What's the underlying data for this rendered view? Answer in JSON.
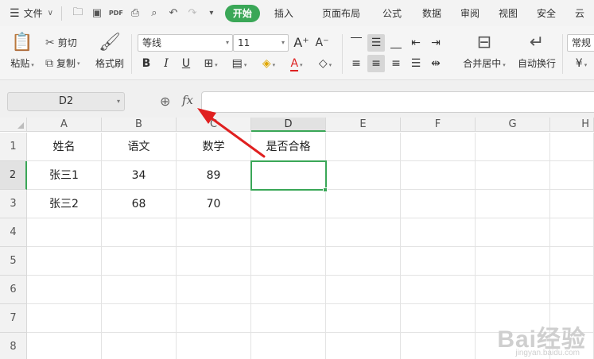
{
  "menubar": {
    "file_label": "文件",
    "tabs": [
      {
        "label": "开始",
        "active": true
      },
      {
        "label": "插入"
      },
      {
        "label": "页面布局"
      },
      {
        "label": "公式"
      },
      {
        "label": "数据"
      },
      {
        "label": "审阅"
      },
      {
        "label": "视图"
      },
      {
        "label": "安全"
      },
      {
        "label": "云"
      }
    ]
  },
  "ribbon": {
    "paste_label": "粘贴",
    "cut_label": "剪切",
    "copy_label": "复制",
    "format_painter_label": "格式刷",
    "font_name": "等线",
    "font_size": "11",
    "merge_center_label": "合并居中",
    "wrap_text_label": "自动换行",
    "number_format": "常规"
  },
  "formula_bar": {
    "name_box": "D2",
    "fx_label": "fx",
    "formula": ""
  },
  "sheet": {
    "columns": [
      "A",
      "B",
      "C",
      "D",
      "E",
      "F",
      "G",
      "H"
    ],
    "rows": [
      "1",
      "2",
      "3",
      "4",
      "5",
      "6",
      "7",
      "8"
    ],
    "cells": [
      [
        "姓名",
        "语文",
        "数学",
        "是否合格"
      ],
      [
        "张三1",
        "34",
        "89",
        ""
      ],
      [
        "张三2",
        "68",
        "70",
        ""
      ]
    ],
    "active_cell": "D2"
  },
  "watermark": {
    "text": "Bai经验",
    "sub": "jingyan.baidu.com"
  },
  "colors": {
    "accent": "#3aa757",
    "arrow": "#e02020"
  }
}
